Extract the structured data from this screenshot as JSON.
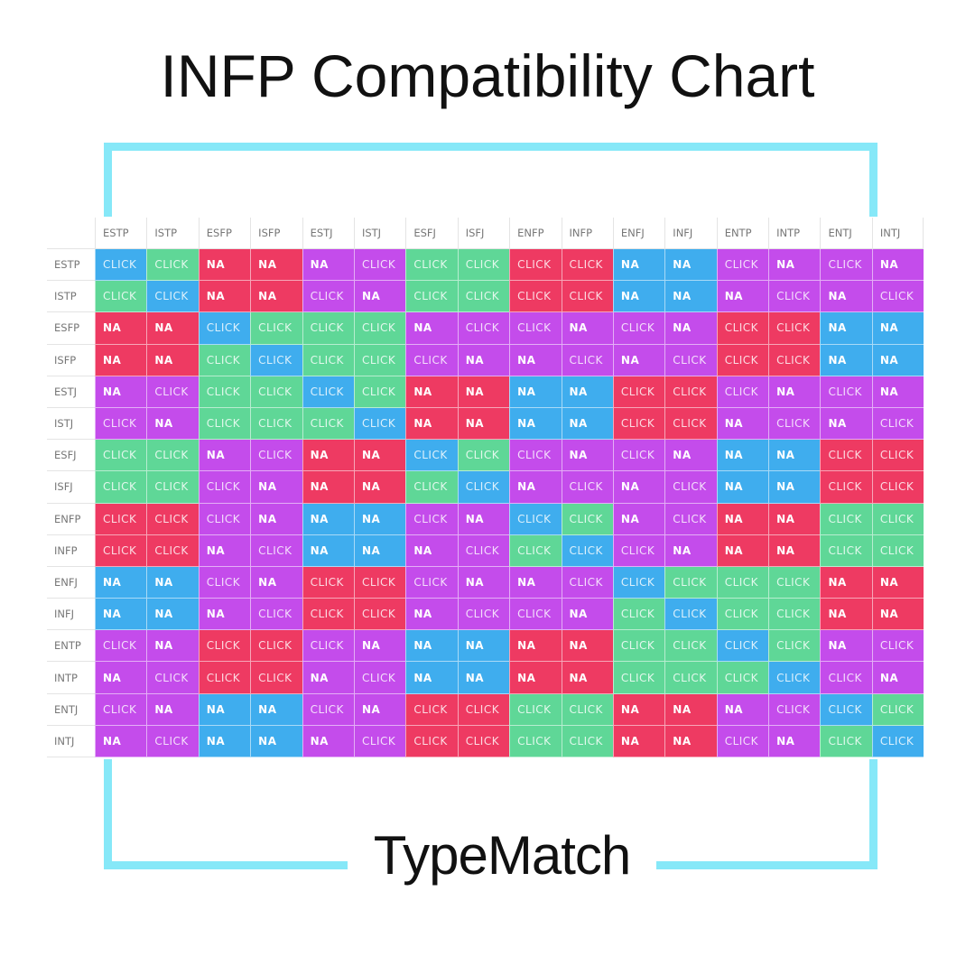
{
  "header": {
    "title": "INFP Compatibility Chart"
  },
  "footer": {
    "brand": "TypeMatch"
  },
  "colors": {
    "B": "#3fadee",
    "G": "#5fd797",
    "R": "#ee3a62",
    "P": "#c44ceb",
    "frame": "#86e8f8"
  },
  "chart_data": {
    "type": "table",
    "title": "INFP Compatibility Chart",
    "columns": [
      "ESTP",
      "ISTP",
      "ESFP",
      "ISFP",
      "ESTJ",
      "ISTJ",
      "ESFJ",
      "ISFJ",
      "ENFP",
      "INFP",
      "ENFJ",
      "INFJ",
      "ENTP",
      "INTP",
      "ENTJ",
      "INTJ"
    ],
    "legend": {
      "B": "blue",
      "G": "green",
      "R": "red",
      "P": "purple"
    },
    "rows": [
      {
        "label": "ESTP",
        "cells": [
          [
            "CLICK",
            "B"
          ],
          [
            "CLICK",
            "G"
          ],
          [
            "NA",
            "R"
          ],
          [
            "NA",
            "R"
          ],
          [
            "NA",
            "P"
          ],
          [
            "CLICK",
            "P"
          ],
          [
            "CLICK",
            "G"
          ],
          [
            "CLICK",
            "G"
          ],
          [
            "CLICK",
            "R"
          ],
          [
            "CLICK",
            "R"
          ],
          [
            "NA",
            "B"
          ],
          [
            "NA",
            "B"
          ],
          [
            "CLICK",
            "P"
          ],
          [
            "NA",
            "P"
          ],
          [
            "CLICK",
            "P"
          ],
          [
            "NA",
            "P"
          ]
        ]
      },
      {
        "label": "ISTP",
        "cells": [
          [
            "CLICK",
            "G"
          ],
          [
            "CLICK",
            "B"
          ],
          [
            "NA",
            "R"
          ],
          [
            "NA",
            "R"
          ],
          [
            "CLICK",
            "P"
          ],
          [
            "NA",
            "P"
          ],
          [
            "CLICK",
            "G"
          ],
          [
            "CLICK",
            "G"
          ],
          [
            "CLICK",
            "R"
          ],
          [
            "CLICK",
            "R"
          ],
          [
            "NA",
            "B"
          ],
          [
            "NA",
            "B"
          ],
          [
            "NA",
            "P"
          ],
          [
            "CLICK",
            "P"
          ],
          [
            "NA",
            "P"
          ],
          [
            "CLICK",
            "P"
          ]
        ]
      },
      {
        "label": "ESFP",
        "cells": [
          [
            "NA",
            "R"
          ],
          [
            "NA",
            "R"
          ],
          [
            "CLICK",
            "B"
          ],
          [
            "CLICK",
            "G"
          ],
          [
            "CLICK",
            "G"
          ],
          [
            "CLICK",
            "G"
          ],
          [
            "NA",
            "P"
          ],
          [
            "CLICK",
            "P"
          ],
          [
            "CLICK",
            "P"
          ],
          [
            "NA",
            "P"
          ],
          [
            "CLICK",
            "P"
          ],
          [
            "NA",
            "P"
          ],
          [
            "CLICK",
            "R"
          ],
          [
            "CLICK",
            "R"
          ],
          [
            "NA",
            "B"
          ],
          [
            "NA",
            "B"
          ]
        ]
      },
      {
        "label": "ISFP",
        "cells": [
          [
            "NA",
            "R"
          ],
          [
            "NA",
            "R"
          ],
          [
            "CLICK",
            "G"
          ],
          [
            "CLICK",
            "B"
          ],
          [
            "CLICK",
            "G"
          ],
          [
            "CLICK",
            "G"
          ],
          [
            "CLICK",
            "P"
          ],
          [
            "NA",
            "P"
          ],
          [
            "NA",
            "P"
          ],
          [
            "CLICK",
            "P"
          ],
          [
            "NA",
            "P"
          ],
          [
            "CLICK",
            "P"
          ],
          [
            "CLICK",
            "R"
          ],
          [
            "CLICK",
            "R"
          ],
          [
            "NA",
            "B"
          ],
          [
            "NA",
            "B"
          ]
        ]
      },
      {
        "label": "ESTJ",
        "cells": [
          [
            "NA",
            "P"
          ],
          [
            "CLICK",
            "P"
          ],
          [
            "CLICK",
            "G"
          ],
          [
            "CLICK",
            "G"
          ],
          [
            "CLICK",
            "B"
          ],
          [
            "CLICK",
            "G"
          ],
          [
            "NA",
            "R"
          ],
          [
            "NA",
            "R"
          ],
          [
            "NA",
            "B"
          ],
          [
            "NA",
            "B"
          ],
          [
            "CLICK",
            "R"
          ],
          [
            "CLICK",
            "R"
          ],
          [
            "CLICK",
            "P"
          ],
          [
            "NA",
            "P"
          ],
          [
            "CLICK",
            "P"
          ],
          [
            "NA",
            "P"
          ]
        ]
      },
      {
        "label": "ISTJ",
        "cells": [
          [
            "CLICK",
            "P"
          ],
          [
            "NA",
            "P"
          ],
          [
            "CLICK",
            "G"
          ],
          [
            "CLICK",
            "G"
          ],
          [
            "CLICK",
            "G"
          ],
          [
            "CLICK",
            "B"
          ],
          [
            "NA",
            "R"
          ],
          [
            "NA",
            "R"
          ],
          [
            "NA",
            "B"
          ],
          [
            "NA",
            "B"
          ],
          [
            "CLICK",
            "R"
          ],
          [
            "CLICK",
            "R"
          ],
          [
            "NA",
            "P"
          ],
          [
            "CLICK",
            "P"
          ],
          [
            "NA",
            "P"
          ],
          [
            "CLICK",
            "P"
          ]
        ]
      },
      {
        "label": "ESFJ",
        "cells": [
          [
            "CLICK",
            "G"
          ],
          [
            "CLICK",
            "G"
          ],
          [
            "NA",
            "P"
          ],
          [
            "CLICK",
            "P"
          ],
          [
            "NA",
            "R"
          ],
          [
            "NA",
            "R"
          ],
          [
            "CLICK",
            "B"
          ],
          [
            "CLICK",
            "G"
          ],
          [
            "CLICK",
            "P"
          ],
          [
            "NA",
            "P"
          ],
          [
            "CLICK",
            "P"
          ],
          [
            "NA",
            "P"
          ],
          [
            "NA",
            "B"
          ],
          [
            "NA",
            "B"
          ],
          [
            "CLICK",
            "R"
          ],
          [
            "CLICK",
            "R"
          ]
        ]
      },
      {
        "label": "ISFJ",
        "cells": [
          [
            "CLICK",
            "G"
          ],
          [
            "CLICK",
            "G"
          ],
          [
            "CLICK",
            "P"
          ],
          [
            "NA",
            "P"
          ],
          [
            "NA",
            "R"
          ],
          [
            "NA",
            "R"
          ],
          [
            "CLICK",
            "G"
          ],
          [
            "CLICK",
            "B"
          ],
          [
            "NA",
            "P"
          ],
          [
            "CLICK",
            "P"
          ],
          [
            "NA",
            "P"
          ],
          [
            "CLICK",
            "P"
          ],
          [
            "NA",
            "B"
          ],
          [
            "NA",
            "B"
          ],
          [
            "CLICK",
            "R"
          ],
          [
            "CLICK",
            "R"
          ]
        ]
      },
      {
        "label": "ENFP",
        "cells": [
          [
            "CLICK",
            "R"
          ],
          [
            "CLICK",
            "R"
          ],
          [
            "CLICK",
            "P"
          ],
          [
            "NA",
            "P"
          ],
          [
            "NA",
            "B"
          ],
          [
            "NA",
            "B"
          ],
          [
            "CLICK",
            "P"
          ],
          [
            "NA",
            "P"
          ],
          [
            "CLICK",
            "B"
          ],
          [
            "CLICK",
            "G"
          ],
          [
            "NA",
            "P"
          ],
          [
            "CLICK",
            "P"
          ],
          [
            "NA",
            "R"
          ],
          [
            "NA",
            "R"
          ],
          [
            "CLICK",
            "G"
          ],
          [
            "CLICK",
            "G"
          ]
        ]
      },
      {
        "label": "INFP",
        "cells": [
          [
            "CLICK",
            "R"
          ],
          [
            "CLICK",
            "R"
          ],
          [
            "NA",
            "P"
          ],
          [
            "CLICK",
            "P"
          ],
          [
            "NA",
            "B"
          ],
          [
            "NA",
            "B"
          ],
          [
            "NA",
            "P"
          ],
          [
            "CLICK",
            "P"
          ],
          [
            "CLICK",
            "G"
          ],
          [
            "CLICK",
            "B"
          ],
          [
            "CLICK",
            "P"
          ],
          [
            "NA",
            "P"
          ],
          [
            "NA",
            "R"
          ],
          [
            "NA",
            "R"
          ],
          [
            "CLICK",
            "G"
          ],
          [
            "CLICK",
            "G"
          ]
        ]
      },
      {
        "label": "ENFJ",
        "cells": [
          [
            "NA",
            "B"
          ],
          [
            "NA",
            "B"
          ],
          [
            "CLICK",
            "P"
          ],
          [
            "NA",
            "P"
          ],
          [
            "CLICK",
            "R"
          ],
          [
            "CLICK",
            "R"
          ],
          [
            "CLICK",
            "P"
          ],
          [
            "NA",
            "P"
          ],
          [
            "NA",
            "P"
          ],
          [
            "CLICK",
            "P"
          ],
          [
            "CLICK",
            "B"
          ],
          [
            "CLICK",
            "G"
          ],
          [
            "CLICK",
            "G"
          ],
          [
            "CLICK",
            "G"
          ],
          [
            "NA",
            "R"
          ],
          [
            "NA",
            "R"
          ]
        ]
      },
      {
        "label": "INFJ",
        "cells": [
          [
            "NA",
            "B"
          ],
          [
            "NA",
            "B"
          ],
          [
            "NA",
            "P"
          ],
          [
            "CLICK",
            "P"
          ],
          [
            "CLICK",
            "R"
          ],
          [
            "CLICK",
            "R"
          ],
          [
            "NA",
            "P"
          ],
          [
            "CLICK",
            "P"
          ],
          [
            "CLICK",
            "P"
          ],
          [
            "NA",
            "P"
          ],
          [
            "CLICK",
            "G"
          ],
          [
            "CLICK",
            "B"
          ],
          [
            "CLICK",
            "G"
          ],
          [
            "CLICK",
            "G"
          ],
          [
            "NA",
            "R"
          ],
          [
            "NA",
            "R"
          ]
        ]
      },
      {
        "label": "ENTP",
        "cells": [
          [
            "CLICK",
            "P"
          ],
          [
            "NA",
            "P"
          ],
          [
            "CLICK",
            "R"
          ],
          [
            "CLICK",
            "R"
          ],
          [
            "CLICK",
            "P"
          ],
          [
            "NA",
            "P"
          ],
          [
            "NA",
            "B"
          ],
          [
            "NA",
            "B"
          ],
          [
            "NA",
            "R"
          ],
          [
            "NA",
            "R"
          ],
          [
            "CLICK",
            "G"
          ],
          [
            "CLICK",
            "G"
          ],
          [
            "CLICK",
            "B"
          ],
          [
            "CLICK",
            "G"
          ],
          [
            "NA",
            "P"
          ],
          [
            "CLICK",
            "P"
          ]
        ]
      },
      {
        "label": "INTP",
        "cells": [
          [
            "NA",
            "P"
          ],
          [
            "CLICK",
            "P"
          ],
          [
            "CLICK",
            "R"
          ],
          [
            "CLICK",
            "R"
          ],
          [
            "NA",
            "P"
          ],
          [
            "CLICK",
            "P"
          ],
          [
            "NA",
            "B"
          ],
          [
            "NA",
            "B"
          ],
          [
            "NA",
            "R"
          ],
          [
            "NA",
            "R"
          ],
          [
            "CLICK",
            "G"
          ],
          [
            "CLICK",
            "G"
          ],
          [
            "CLICK",
            "G"
          ],
          [
            "CLICK",
            "B"
          ],
          [
            "CLICK",
            "P"
          ],
          [
            "NA",
            "P"
          ]
        ]
      },
      {
        "label": "ENTJ",
        "cells": [
          [
            "CLICK",
            "P"
          ],
          [
            "NA",
            "P"
          ],
          [
            "NA",
            "B"
          ],
          [
            "NA",
            "B"
          ],
          [
            "CLICK",
            "P"
          ],
          [
            "NA",
            "P"
          ],
          [
            "CLICK",
            "R"
          ],
          [
            "CLICK",
            "R"
          ],
          [
            "CLICK",
            "G"
          ],
          [
            "CLICK",
            "G"
          ],
          [
            "NA",
            "R"
          ],
          [
            "NA",
            "R"
          ],
          [
            "NA",
            "P"
          ],
          [
            "CLICK",
            "P"
          ],
          [
            "CLICK",
            "B"
          ],
          [
            "CLICK",
            "G"
          ]
        ]
      },
      {
        "label": "INTJ",
        "cells": [
          [
            "NA",
            "P"
          ],
          [
            "CLICK",
            "P"
          ],
          [
            "NA",
            "B"
          ],
          [
            "NA",
            "B"
          ],
          [
            "NA",
            "P"
          ],
          [
            "CLICK",
            "P"
          ],
          [
            "CLICK",
            "R"
          ],
          [
            "CLICK",
            "R"
          ],
          [
            "CLICK",
            "G"
          ],
          [
            "CLICK",
            "G"
          ],
          [
            "NA",
            "R"
          ],
          [
            "NA",
            "R"
          ],
          [
            "CLICK",
            "P"
          ],
          [
            "NA",
            "P"
          ],
          [
            "CLICK",
            "G"
          ],
          [
            "CLICK",
            "B"
          ]
        ]
      }
    ]
  }
}
